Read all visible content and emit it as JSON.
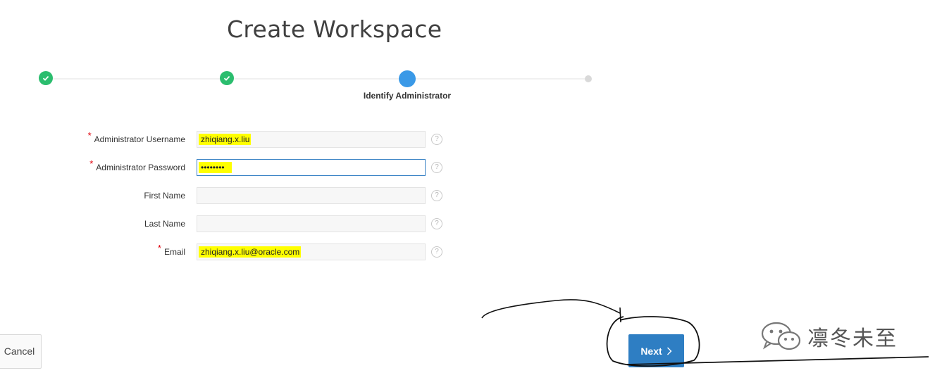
{
  "page": {
    "title": "Create Workspace"
  },
  "wizard": {
    "current_step_label": "Identify Administrator"
  },
  "form": {
    "username": {
      "label": "Administrator Username",
      "value": "zhiqiang.x.liu",
      "required": true
    },
    "password": {
      "label": "Administrator Password",
      "value": "••••••••",
      "required": true
    },
    "first_name": {
      "label": "First Name",
      "value": ""
    },
    "last_name": {
      "label": "Last Name",
      "value": ""
    },
    "email": {
      "label": "Email",
      "value": "zhiqiang.x.liu@oracle.com",
      "required": true
    },
    "required_marker": "*",
    "help_glyph": "?"
  },
  "buttons": {
    "cancel": "Cancel",
    "next": "Next"
  },
  "watermark": {
    "text": "凛冬未至"
  },
  "colors": {
    "accent": "#2e7ec3",
    "done": "#2bbd6e",
    "current": "#3a99e7",
    "highlight": "#ffff00"
  }
}
